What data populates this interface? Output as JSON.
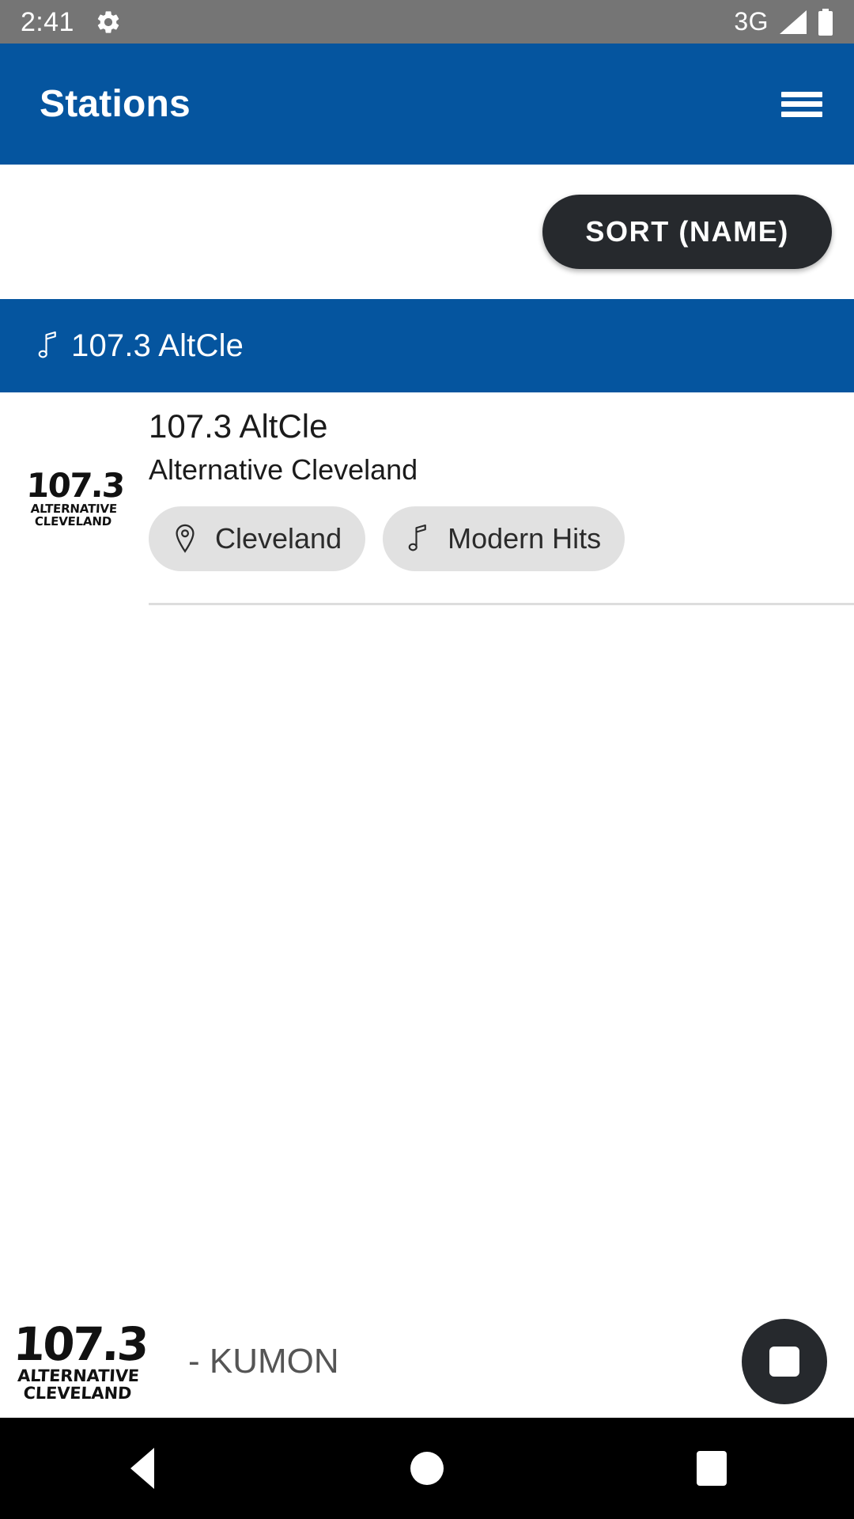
{
  "status_bar": {
    "time": "2:41",
    "gear_icon": "gear-icon",
    "network": "3G",
    "signal_icon": "signal-triangle-icon",
    "battery_icon": "battery-full-icon",
    "background_color": "#757575"
  },
  "app_bar": {
    "title": "Stations",
    "menu_icon": "hamburger-menu-icon",
    "background_color": "#05559F"
  },
  "sort_bar": {
    "sort_button_label": "SORT (NAME)",
    "button_color": "#26292D"
  },
  "section_header": {
    "icon": "music-note-icon",
    "label": "107.3 AltCle",
    "background_color": "#05559F"
  },
  "stations": [
    {
      "logo": {
        "line1": "107.3",
        "line2": "ALTERNATIVE",
        "line3": "CLEVELAND"
      },
      "name": "107.3 AltCle",
      "description": "Alternative Cleveland",
      "chips": [
        {
          "icon": "location-pin-icon",
          "label": "Cleveland"
        },
        {
          "icon": "music-note-icon",
          "label": "Modern Hits"
        }
      ]
    }
  ],
  "player": {
    "logo": {
      "line1": "107.3",
      "line2": "ALTERNATIVE",
      "line3": "CLEVELAND"
    },
    "now_playing": "- KUMON",
    "stop_button_icon": "stop-square-icon",
    "stop_button_color": "#26292D"
  },
  "navigation_bar": {
    "back_icon": "back-triangle-icon",
    "home_icon": "home-circle-icon",
    "recents_icon": "recents-square-icon",
    "background_color": "#000000"
  }
}
